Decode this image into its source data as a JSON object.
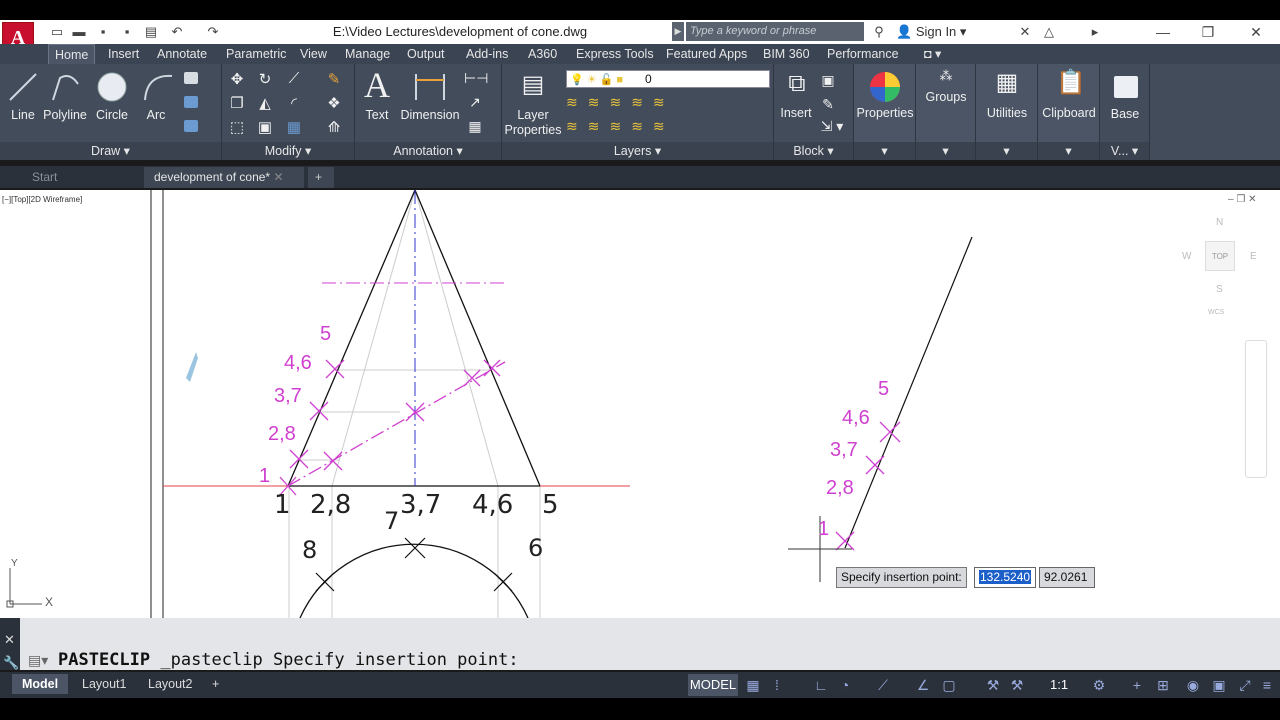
{
  "window": {
    "title": "E:\\Video Lectures\\development of cone.dwg",
    "search_placeholder": "Type a keyword or phrase",
    "sign_in": "Sign In"
  },
  "ribbon_tabs": [
    "Home",
    "Insert",
    "Annotate",
    "Parametric",
    "View",
    "Manage",
    "Output",
    "Add-ins",
    "A360",
    "Express Tools",
    "Featured Apps",
    "BIM 360",
    "Performance"
  ],
  "draw": {
    "label": "Draw",
    "tools": [
      "Line",
      "Polyline",
      "Circle",
      "Arc"
    ]
  },
  "modify": {
    "label": "Modify"
  },
  "annotation": {
    "label": "Annotation",
    "tools": [
      "Text",
      "Dimension"
    ]
  },
  "layers": {
    "label": "Layers",
    "layer_properties": "Layer Properties",
    "current_layer": "0"
  },
  "block": {
    "label": "Block",
    "insert": "Insert"
  },
  "properties": {
    "label": "Properties"
  },
  "groups": {
    "label": "Groups"
  },
  "utilities": {
    "label": "Utilities"
  },
  "clipboard": {
    "label": "Clipboard"
  },
  "view_panel": {
    "base": "Base",
    "label": "V..."
  },
  "file_tabs": {
    "start": "Start",
    "current": "development of cone*"
  },
  "viewport": {
    "label": "[−][Top][2D Wireframe]"
  },
  "viewcube": {
    "top": "TOP",
    "n": "N",
    "s": "S",
    "e": "E",
    "w": "W",
    "wcs": "WCS"
  },
  "drawing_labels": {
    "left": [
      "5",
      "4,6",
      "3,7",
      "2,8",
      "1"
    ],
    "base": [
      "1",
      "2,8",
      "3,7",
      "4,6",
      "5"
    ],
    "circle": [
      "7",
      "8",
      "6"
    ],
    "right": [
      "5",
      "4,6",
      "3,7",
      "2,8",
      "1"
    ]
  },
  "ucs": {
    "x": "X",
    "y": "Y"
  },
  "prompt": {
    "tooltip": "Specify insertion point:",
    "x": "132.5240",
    "y": "92.0261"
  },
  "command": {
    "name": "PASTECLIP",
    "rest": " _pasteclip Specify insertion point:"
  },
  "layout_tabs": [
    "Model",
    "Layout1",
    "Layout2"
  ],
  "status": {
    "model": "MODEL",
    "scale": "1:1"
  }
}
